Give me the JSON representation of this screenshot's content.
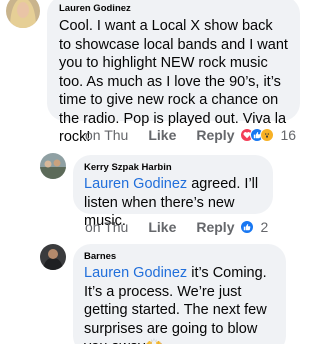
{
  "comments": [
    {
      "author": "Lauren Godinez",
      "body": "Cool. I want a Local X show back to showcase local bands and I want you to highlight NEW rock music too. As much as I love the 90’s, it’s time to give new rock a chance on the radio. Pop is played out. Viva la rock!",
      "timestamp": "on Thu",
      "like_label": "Like",
      "reply_label": "Reply",
      "reaction_icons": [
        "love-reaction-icon",
        "like-reaction-icon",
        "wow-reaction-icon"
      ],
      "reaction_count": "16"
    },
    {
      "author": "Kerry Szpak Harbin",
      "mention": "Lauren Godinez",
      "body": " agreed. I’ll listen when there’s new music.",
      "timestamp": "on Thu",
      "like_label": "Like",
      "reply_label": "Reply",
      "reaction_icons": [
        "like-reaction-icon"
      ],
      "reaction_count": "2"
    },
    {
      "author": "Barnes",
      "mention": "Lauren Godinez",
      "body": " it’s Coming. It’s a process. We’re just getting started. The next few surprises are going to blow you away",
      "emoji": "🙌"
    }
  ],
  "colors": {
    "bubble": "#f0f2f5",
    "mention": "#216fdb",
    "meta": "#65676b",
    "like": "#1877f2",
    "love": "#f33e58"
  }
}
